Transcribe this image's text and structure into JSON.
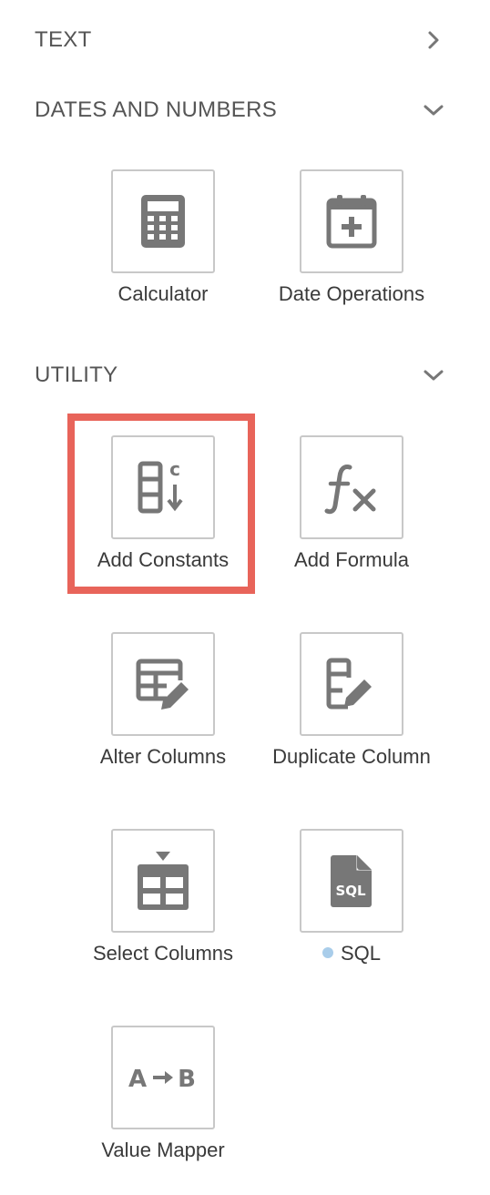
{
  "sections": {
    "text": {
      "title": "TEXT",
      "state": "collapsed"
    },
    "dates": {
      "title": "DATES AND NUMBERS",
      "state": "expanded"
    },
    "utility": {
      "title": "UTILITY",
      "state": "expanded"
    }
  },
  "tiles": {
    "calculator": {
      "label": "Calculator",
      "icon": "calculator-icon"
    },
    "date_operations": {
      "label": "Date Operations",
      "icon": "calendar-plus-icon"
    },
    "add_constants": {
      "label": "Add Constants",
      "icon": "add-constants-icon",
      "highlighted": true
    },
    "add_formula": {
      "label": "Add Formula",
      "icon": "formula-fx-icon"
    },
    "alter_columns": {
      "label": "Alter Columns",
      "icon": "alter-columns-icon"
    },
    "duplicate_column": {
      "label": "Duplicate Column",
      "icon": "duplicate-column-icon"
    },
    "select_columns": {
      "label": "Select Columns",
      "icon": "select-columns-icon"
    },
    "sql": {
      "label": "SQL",
      "icon": "sql-file-icon",
      "icon_text": "SQL",
      "dot_color": "#a9cdea"
    },
    "value_mapper": {
      "label": "Value Mapper",
      "icon": "value-mapper-icon",
      "icon_text_a": "A",
      "icon_text_b": "B"
    }
  },
  "colors": {
    "icon": "#777777",
    "tile_border": "#c8c8c8",
    "highlight": "#e8645a",
    "text": "#3a3a3a"
  }
}
